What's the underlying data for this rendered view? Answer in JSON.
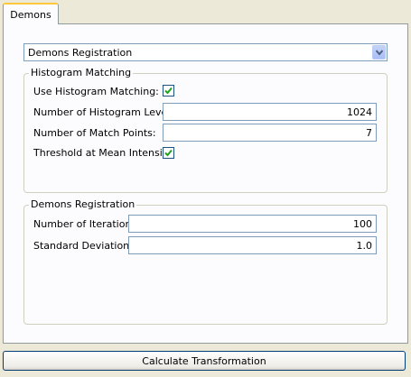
{
  "tabs": [
    {
      "label": "Demons"
    }
  ],
  "method_select": {
    "value": "Demons Registration"
  },
  "histogram_matching": {
    "title": "Histogram Matching",
    "use_label": "Use Histogram Matching:",
    "use_checked": true,
    "levels_label": "Number of Histogram Levels:",
    "levels_value": "1024",
    "match_points_label": "Number of Match Points:",
    "match_points_value": "7",
    "threshold_label": "Threshold at Mean Intensity:",
    "threshold_checked": true
  },
  "demons_registration": {
    "title": "Demons Registration",
    "iterations_label": "Number of Iterations:",
    "iterations_value": "100",
    "std_dev_label": "Standard Deviation:",
    "std_dev_value": "1.0"
  },
  "actions": {
    "calculate_label": "Calculate Transformation"
  },
  "icons": {
    "dropdown": "chevron-down-icon",
    "check": "checkmark-icon"
  },
  "colors": {
    "check": "#21a121",
    "tab_highlight": "#ffc83c",
    "panel": "#fcfcfe"
  }
}
